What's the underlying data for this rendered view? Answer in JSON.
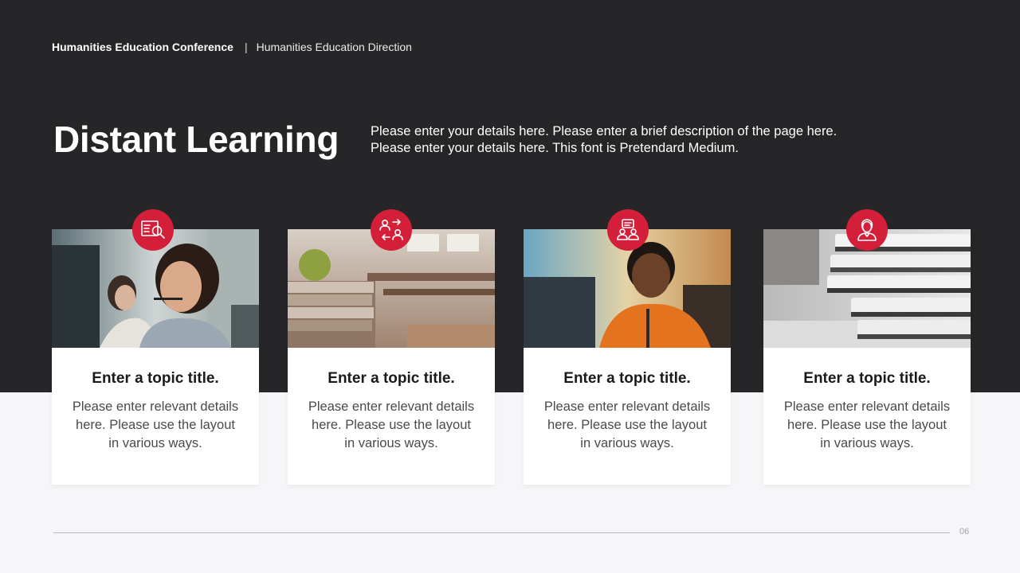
{
  "header": {
    "conference": "Humanities Education Conference",
    "separator": "|",
    "direction": "Humanities Education Direction"
  },
  "title": "Distant Learning",
  "description": {
    "line1": "Please enter your details here. Please enter a brief description of the page here.",
    "line2": "Please enter your details here. This font is Pretendard Medium."
  },
  "cards": [
    {
      "icon": "search-document-icon",
      "image": "woman-with-headset-photo",
      "title": "Enter a topic title.",
      "body": "Please enter relevant details here. Please use the layout in various ways."
    },
    {
      "icon": "people-exchange-icon",
      "image": "classroom-books-apple-photo",
      "title": "Enter a topic title.",
      "body": "Please enter relevant details here. Please use the layout in various ways."
    },
    {
      "icon": "group-chat-icon",
      "image": "man-with-headset-photo",
      "title": "Enter a topic title.",
      "body": "Please enter relevant details here. Please use the layout in various ways."
    },
    {
      "icon": "user-profile-icon",
      "image": "stacked-books-photo",
      "title": "Enter a topic title.",
      "body": "Please enter relevant details here. Please use the layout in various ways."
    }
  ],
  "page_number": "06",
  "colors": {
    "accent": "#d41f3b",
    "dark_band": "#262527",
    "background": "#f6f6f8"
  }
}
